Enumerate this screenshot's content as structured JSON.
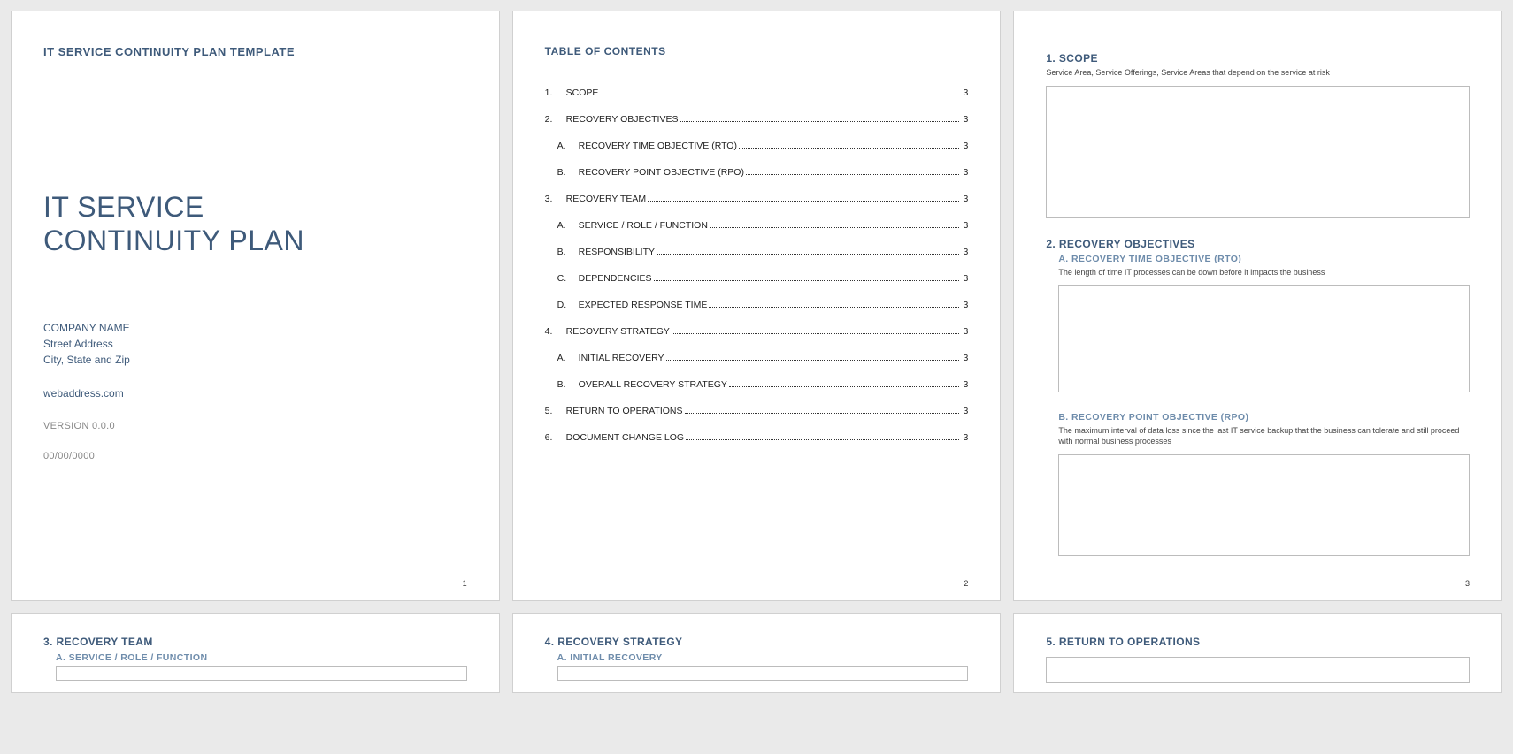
{
  "page1": {
    "template_name": "IT SERVICE CONTINUITY PLAN TEMPLATE",
    "title_line1": "IT SERVICE",
    "title_line2": "CONTINUITY PLAN",
    "company": "COMPANY NAME",
    "street": "Street Address",
    "city": "City, State and Zip",
    "web": "webaddress.com",
    "version": "VERSION 0.0.0",
    "date": "00/00/0000",
    "pagenum": "1"
  },
  "page2": {
    "toc_title": "TABLE OF CONTENTS",
    "items": [
      {
        "num": "1.",
        "label": "SCOPE",
        "pg": "3"
      },
      {
        "num": "2.",
        "label": "RECOVERY OBJECTIVES",
        "pg": "3"
      },
      {
        "num": "A.",
        "label": "RECOVERY TIME OBJECTIVE (RTO)",
        "pg": "3",
        "sub": true
      },
      {
        "num": "B.",
        "label": "RECOVERY POINT OBJECTIVE (RPO)",
        "pg": "3",
        "sub": true
      },
      {
        "num": "3.",
        "label": "RECOVERY TEAM",
        "pg": "3"
      },
      {
        "num": "A.",
        "label": "SERVICE / ROLE / FUNCTION",
        "pg": "3",
        "sub": true
      },
      {
        "num": "B.",
        "label": "RESPONSIBILITY",
        "pg": "3",
        "sub": true
      },
      {
        "num": "C.",
        "label": "DEPENDENCIES",
        "pg": "3",
        "sub": true
      },
      {
        "num": "D.",
        "label": "EXPECTED RESPONSE TIME",
        "pg": "3",
        "sub": true
      },
      {
        "num": "4.",
        "label": "RECOVERY STRATEGY",
        "pg": "3"
      },
      {
        "num": "A.",
        "label": "INITIAL RECOVERY",
        "pg": "3",
        "sub": true
      },
      {
        "num": "B.",
        "label": "OVERALL RECOVERY STRATEGY",
        "pg": "3",
        "sub": true
      },
      {
        "num": "5.",
        "label": "RETURN TO OPERATIONS",
        "pg": "3"
      },
      {
        "num": "6.",
        "label": "DOCUMENT CHANGE LOG",
        "pg": "3"
      }
    ],
    "pagenum": "2"
  },
  "page3": {
    "scope_title": "1.  SCOPE",
    "scope_desc": "Service Area, Service Offerings, Service Areas that depend on the service at risk",
    "rec_obj_title": "2.  RECOVERY OBJECTIVES",
    "rto_title": "A.  RECOVERY TIME OBJECTIVE (RTO)",
    "rto_desc": "The length of time IT processes can be down before it impacts the business",
    "rpo_title": "B.  RECOVERY POINT OBJECTIVE (RPO)",
    "rpo_desc": "The maximum interval of data loss since the last IT service backup that the business can tolerate and still proceed with normal business processes",
    "pagenum": "3"
  },
  "page4": {
    "title": "3.  RECOVERY TEAM",
    "sub_a": "A.  SERVICE / ROLE / FUNCTION"
  },
  "page5": {
    "title": "4.  RECOVERY STRATEGY",
    "sub_a": "A.  INITIAL RECOVERY"
  },
  "page6": {
    "title": "5.  RETURN TO OPERATIONS"
  }
}
